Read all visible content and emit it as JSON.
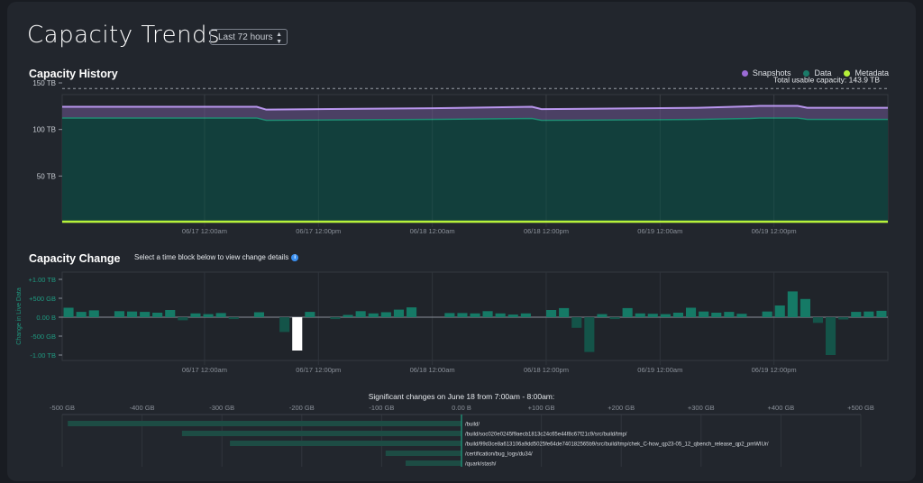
{
  "page": {
    "title": "Capacity Trends",
    "range_select": "Last 72 hours"
  },
  "history": {
    "title": "Capacity History",
    "legend": [
      {
        "name": "Snapshots",
        "color": "#9b6bd6"
      },
      {
        "name": "Data",
        "color": "#1b7a68"
      },
      {
        "name": "Metadata",
        "color": "#b7f23a"
      }
    ],
    "total_usable_label": "Total usable capacity: 143.9 TB"
  },
  "change": {
    "title": "Capacity Change",
    "hint": "Select a time block below to view change details",
    "info_icon": "info-icon"
  },
  "detail": {
    "title": "Significant changes on June 18 from 7:00am - 8:00am:"
  },
  "chart_data": [
    {
      "type": "area",
      "title": "Capacity History",
      "y_unit": "TB",
      "ylim": [
        0,
        150
      ],
      "y_ticks": [
        "150 TB",
        "100 TB",
        "50 TB"
      ],
      "y_tick_values": [
        150,
        100,
        50
      ],
      "x_ticks": [
        "06/17 12:00am",
        "06/17 12:00pm",
        "06/18 12:00am",
        "06/18 12:00pm",
        "06/19 12:00am",
        "06/19 12:00pm"
      ],
      "x_range_hours": [
        -15,
        72
      ],
      "x_tick_hours": [
        0,
        12,
        24,
        36,
        48,
        60
      ],
      "total_usable_capacity": 143.9,
      "x": [
        -15,
        5.5,
        6.5,
        24,
        34.5,
        35.5,
        52,
        57.5,
        58.5,
        62.5,
        63.5,
        72
      ],
      "series": [
        {
          "name": "Metadata",
          "values": [
            0.8,
            0.8,
            0.8,
            0.8,
            0.8,
            0.8,
            0.8,
            0.8,
            0.8,
            0.8,
            0.8,
            0.8
          ]
        },
        {
          "name": "Data",
          "values": [
            111.5,
            111.5,
            109,
            110,
            111,
            109,
            110,
            111,
            111.5,
            111.5,
            110,
            110
          ]
        },
        {
          "name": "Snapshots",
          "values": [
            12,
            12,
            11.5,
            12,
            12.5,
            12,
            12.5,
            13,
            13,
            13,
            12.5,
            12.5
          ]
        }
      ],
      "grid": true,
      "legend_position": "top-right"
    },
    {
      "type": "bar",
      "title": "Capacity Change",
      "ylabel": "Change in Live Data",
      "ylim": [
        -1.1,
        1.15
      ],
      "y_ticks": [
        "+1.00 TB",
        "+500 GB",
        "0.00 B",
        "-500 GB",
        "-1.00 TB"
      ],
      "y_tick_values": [
        1,
        0.5,
        0,
        -0.5,
        -1
      ],
      "x_ticks": [
        "06/17 12:00am",
        "06/17 12:00pm",
        "06/18 12:00am",
        "06/18 12:00pm",
        "06/19 12:00am",
        "06/19 12:00pm"
      ],
      "x_tick_hours": [
        0,
        12,
        24,
        36,
        48,
        60
      ],
      "values": [
        0.25,
        0.14,
        0.18,
        0,
        0.16,
        0.15,
        0.14,
        0.12,
        0.19,
        -0.08,
        0.1,
        0.08,
        0.11,
        -0.05,
        0,
        0.13,
        0,
        -0.39,
        -0.88,
        0.14,
        0,
        -0.05,
        0.06,
        0.16,
        0.1,
        0.13,
        0.2,
        0.26,
        0,
        0,
        0.11,
        0.11,
        0.1,
        0.16,
        0.1,
        0.07,
        0.1,
        0,
        0.19,
        0.24,
        -0.28,
        -0.92,
        0.08,
        -0.05,
        0.24,
        0.1,
        0.09,
        0.08,
        0.12,
        0.25,
        0.15,
        0.12,
        0.14,
        0.09,
        0,
        0.15,
        0.31,
        0.68,
        0.48,
        -0.15,
        -1.0,
        -0.06,
        0.14,
        0.15,
        0.17
      ],
      "selected_index": 18,
      "unit": "TB"
    },
    {
      "type": "bar",
      "orientation": "horizontal",
      "title": "Significant changes on June 18 from 7:00am - 8:00am:",
      "x_ticks": [
        "-500 GB",
        "-400 GB",
        "-300 GB",
        "-200 GB",
        "-100 GB",
        "0.00 B",
        "+100 GB",
        "+200 GB",
        "+300 GB",
        "+400 GB",
        "+500 GB"
      ],
      "x_tick_values": [
        -500,
        -400,
        -300,
        -200,
        -100,
        0,
        100,
        200,
        300,
        400,
        500
      ],
      "xlim": [
        -500,
        500
      ],
      "unit": "GB",
      "categories": [
        "/build/",
        "/build/soc020e0245f9aecb1813c24c65e44f8c67f21c9/src/build/tmp/",
        "/build/99d3ce8a613106a9dd5025fe64de740182565b9/src/build/tmp/chek_C-how_qp23-05_12_qbench_release_qp2_pmWIUr/",
        "/certification/bug_logs/du34/",
        "/quark/stash/"
      ],
      "values": [
        -493,
        -350,
        -290,
        -95,
        -70
      ]
    }
  ]
}
